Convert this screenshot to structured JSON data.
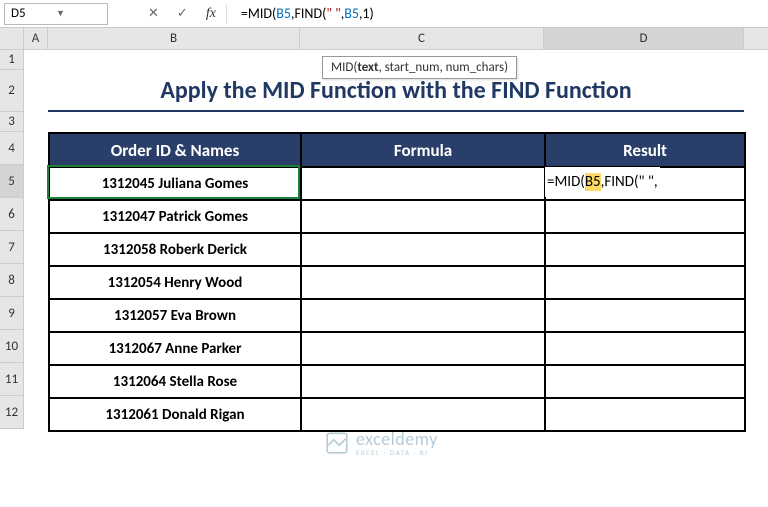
{
  "namebox": {
    "value": "D5"
  },
  "formula_bar": {
    "prefix": "=MID(",
    "ref1": "B5",
    "mid1": ",FIND(",
    "str": "\" \"",
    "mid2": ",",
    "ref2": "B5",
    "mid3": ",1)"
  },
  "tooltip": {
    "fn": "MID",
    "args_bold": "text",
    "args_rest": ", start_num, num_chars)"
  },
  "col_headers": [
    "A",
    "B",
    "C",
    "D"
  ],
  "row_headers": [
    "1",
    "2",
    "3",
    "4",
    "5",
    "6",
    "7",
    "8",
    "9",
    "10",
    "11",
    "12"
  ],
  "title": "Apply the MID Function with the FIND Function",
  "table": {
    "headers": [
      "Order ID & Names",
      "Formula",
      "Result"
    ],
    "rows": [
      {
        "b": "1312045 Juliana Gomes",
        "c": "",
        "d": ""
      },
      {
        "b": "1312047 Patrick Gomes",
        "c": "",
        "d": ""
      },
      {
        "b": "1312058 Roberk Derick",
        "c": "",
        "d": ""
      },
      {
        "b": "1312054 Henry Wood",
        "c": "",
        "d": ""
      },
      {
        "b": "1312057 Eva Brown",
        "c": "",
        "d": ""
      },
      {
        "b": "1312067 Anne Parker",
        "c": "",
        "d": ""
      },
      {
        "b": "1312064 Stella Rose",
        "c": "",
        "d": ""
      },
      {
        "b": "1312061 Donald Rigan",
        "c": "",
        "d": ""
      }
    ]
  },
  "edit_cell": {
    "p1": "=MID(",
    "hl": "B5",
    "p2": ",FIND(\" \","
  },
  "watermark": {
    "name": "exceldemy",
    "sub": "EXCEL · DATA · BI"
  }
}
